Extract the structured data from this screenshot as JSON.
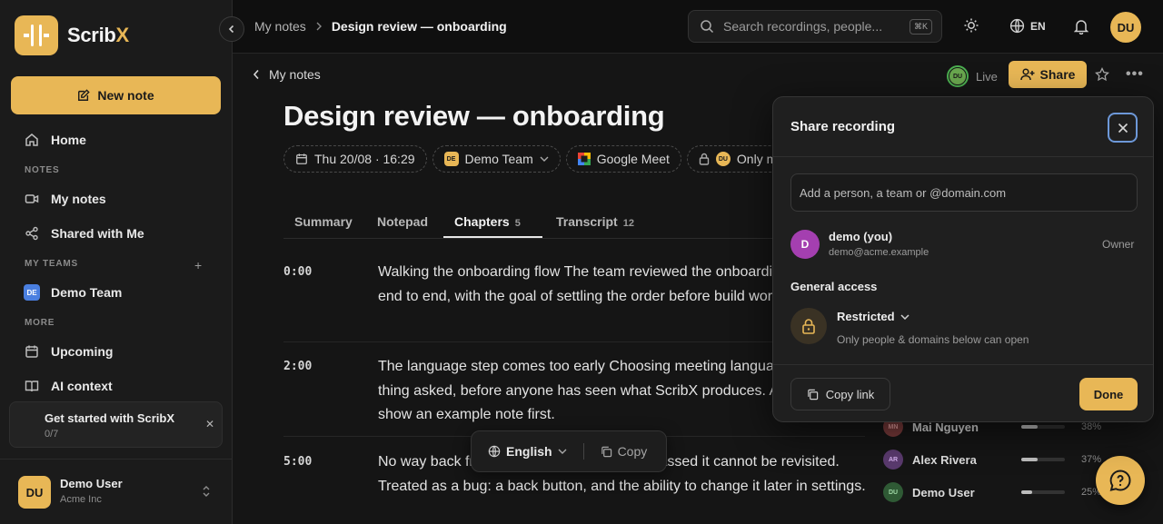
{
  "app": {
    "logo_text": "Scrib",
    "logo_x": "X",
    "accent_color": "#e8b756"
  },
  "sidebar": {
    "new_note_label": "New note",
    "home_label": "Home",
    "sections": {
      "notes": "NOTES",
      "teams": "MY TEAMS",
      "more": "MORE"
    },
    "items": {
      "my_notes": "My notes",
      "shared": "Shared with Me",
      "team_badge": "DE",
      "team": "Demo Team",
      "upcoming": "Upcoming",
      "ai_context": "AI context"
    },
    "get_started": {
      "title": "Get started with ScribX",
      "progress": "0/7"
    },
    "user": {
      "initials": "DU",
      "name": "Demo User",
      "org": "Acme Inc"
    }
  },
  "topbar": {
    "breadcrumb": [
      "My notes",
      "Design review — onboarding"
    ],
    "search_placeholder": "Search recordings, people...",
    "search_shortcut": "⌘K",
    "language": "EN",
    "avatar": "DU"
  },
  "note": {
    "back_label": "My notes",
    "live_initials": "DU",
    "live_label": "Live",
    "share_label": "Share",
    "title": "Design review — onboarding",
    "chips": {
      "date": "Thu 20/08 · 16:29",
      "team_badge": "DE",
      "team": "Demo Team",
      "platform": "Google Meet",
      "visibility_avatar": "DU",
      "visibility": "Only me"
    },
    "tabs": [
      {
        "label": "Summary",
        "count": ""
      },
      {
        "label": "Notepad",
        "count": ""
      },
      {
        "label": "Chapters",
        "count": "5"
      },
      {
        "label": "Transcript",
        "count": "12"
      }
    ],
    "chapters": [
      {
        "time": "0:00",
        "title": "Walking the onboarding flow",
        "text": "The team reviewed the onboarding screens end to end, with the goal of settling the order before build work."
      },
      {
        "time": "2:00",
        "title": "The language step comes too early",
        "text": "Choosing meeting language is the first thing asked, before anyone has seen what ScribX produces. Agreed to show an example note first."
      },
      {
        "time": "5:00",
        "title": "No way back from a step",
        "text": "Once the step is passed it cannot be revisited. Treated as a bug: a back button, and the ability to change it later in settings."
      }
    ],
    "transcript_language": "English",
    "copy_label": "Copy"
  },
  "speakers": [
    {
      "initials": "MN",
      "name": "Mai Nguyen",
      "percent": "38%",
      "share": 38,
      "color": "#7a3b3b",
      "text_color": "#e8a0a0"
    },
    {
      "initials": "AR",
      "name": "Alex Rivera",
      "percent": "37%",
      "share": 37,
      "color": "#5a3a6e",
      "text_color": "#d6b0ef"
    },
    {
      "initials": "DU",
      "name": "Demo User",
      "percent": "25%",
      "share": 25,
      "color": "#2f5a35",
      "text_color": "#9fd8a6"
    }
  ],
  "share_modal": {
    "title": "Share recording",
    "add_placeholder": "Add a person, a team or @domain.com",
    "person": {
      "initial": "D",
      "name": "demo (you)",
      "email": "demo@acme.example",
      "role": "Owner"
    },
    "general_access_label": "General access",
    "access_level": "Restricted",
    "access_desc": "Only people & domains below can open",
    "copy_link_label": "Copy link",
    "done_label": "Done"
  }
}
